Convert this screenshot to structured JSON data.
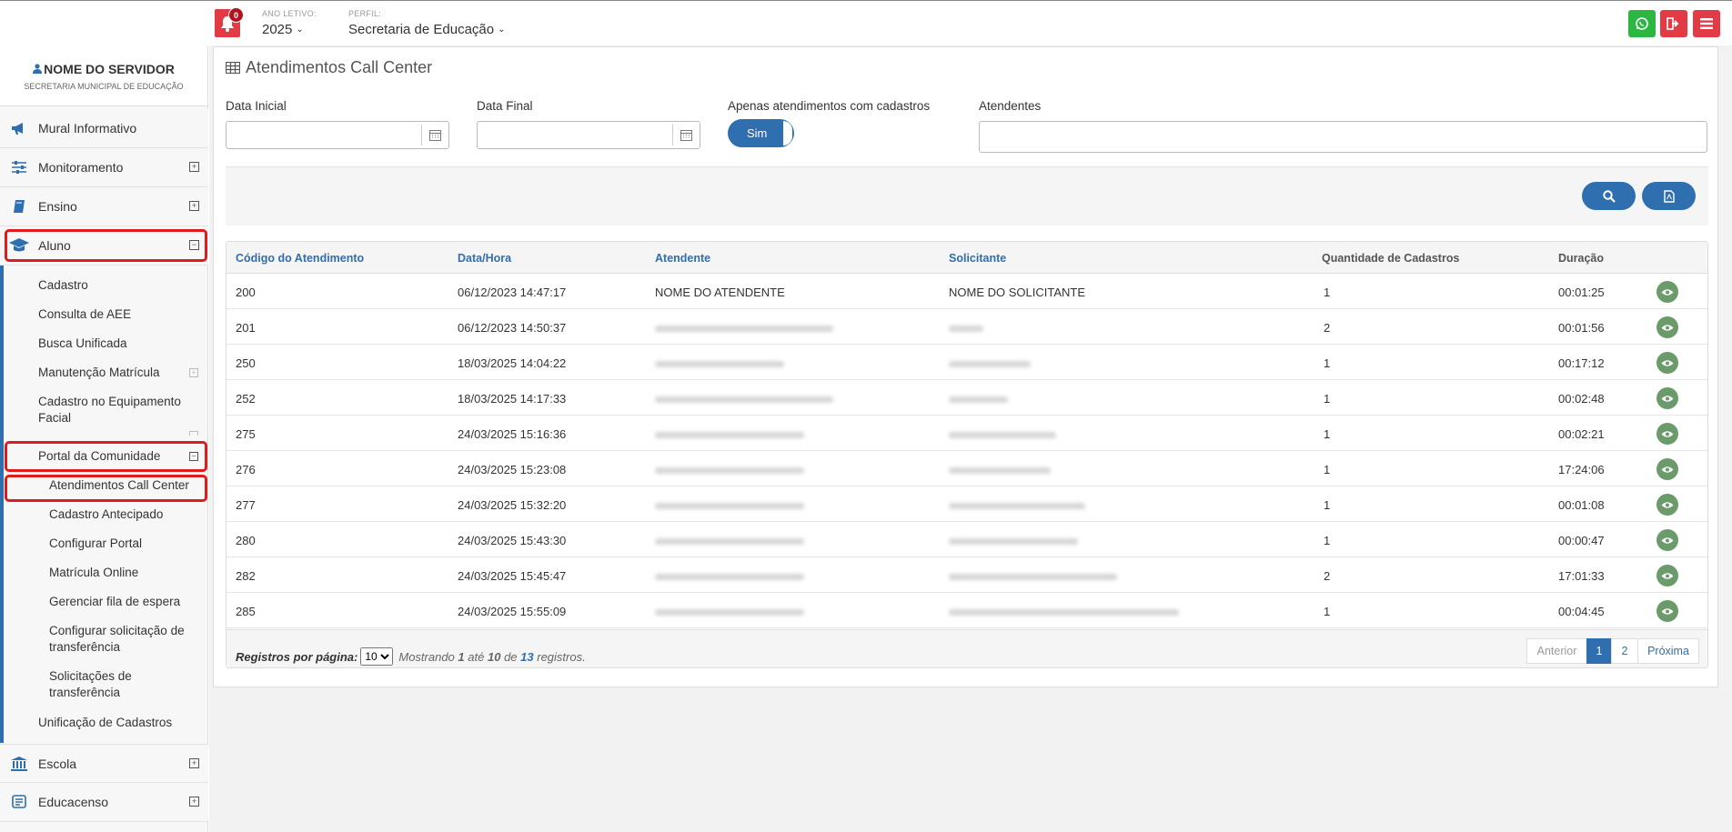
{
  "topbar": {
    "notification_count": "0",
    "ano_label": "ANO LETIVO:",
    "ano_value": "2025",
    "perfil_label": "PERFIL:",
    "perfil_value": "Secretaria de Educação"
  },
  "user": {
    "name": "NOME DO SERVIDOR",
    "org": "SECRETARIA MUNICIPAL DE EDUCAÇÃO"
  },
  "sidebar": {
    "mural": "Mural Informativo",
    "monitoramento": "Monitoramento",
    "ensino": "Ensino",
    "aluno": "Aluno",
    "aluno_items": {
      "cadastro": "Cadastro",
      "consulta_aee": "Consulta de AEE",
      "busca": "Busca Unificada",
      "manutencao": "Manutenção Matrícula",
      "equipamento_l1": "Cadastro no Equipamento",
      "equipamento_l2": "Facial",
      "portal": "Portal da Comunidade",
      "unificacao": "Unificação de Cadastros"
    },
    "portal_items": {
      "call_center": "Atendimentos Call Center",
      "antecipado": "Cadastro Antecipado",
      "configurar": "Configurar Portal",
      "matricula": "Matrícula Online",
      "fila": "Gerenciar fila de espera",
      "config_transf_l1": "Configurar solicitação de",
      "config_transf_l2": "transferência",
      "solic_l1": "Solicitações de",
      "solic_l2": "transferência"
    },
    "escola": "Escola",
    "educacenso": "Educacenso"
  },
  "page": {
    "title": "Atendimentos Call Center",
    "filters": {
      "data_inicial": "Data Inicial",
      "data_final": "Data Final",
      "apenas": "Apenas atendimentos com cadastros",
      "toggle_value": "Sim",
      "atendentes": "Atendentes"
    }
  },
  "table": {
    "headers": [
      "Código do Atendimento",
      "Data/Hora",
      "Atendente",
      "Solicitante",
      "Quantidade de Cadastros",
      "Duração"
    ],
    "rows": [
      {
        "codigo": "200",
        "data": "06/12/2023 14:47:17",
        "atendente": "NOME DO ATENDENTE",
        "solicitante": "NOME DO SOLICITANTE",
        "qtd": "1",
        "duracao": "00:01:25"
      },
      {
        "codigo": "201",
        "data": "06/12/2023 14:50:37",
        "atendente": "",
        "solicitante": "",
        "qtd": "2",
        "duracao": "00:01:56"
      },
      {
        "codigo": "250",
        "data": "18/03/2025 14:04:22",
        "atendente": "",
        "solicitante": "",
        "qtd": "1",
        "duracao": "00:17:12"
      },
      {
        "codigo": "252",
        "data": "18/03/2025 14:17:33",
        "atendente": "",
        "solicitante": "",
        "qtd": "1",
        "duracao": "00:02:48"
      },
      {
        "codigo": "275",
        "data": "24/03/2025 15:16:36",
        "atendente": "",
        "solicitante": "",
        "qtd": "1",
        "duracao": "00:02:21"
      },
      {
        "codigo": "276",
        "data": "24/03/2025 15:23:08",
        "atendente": "",
        "solicitante": "",
        "qtd": "1",
        "duracao": "17:24:06"
      },
      {
        "codigo": "277",
        "data": "24/03/2025 15:32:20",
        "atendente": "",
        "solicitante": "",
        "qtd": "1",
        "duracao": "00:01:08"
      },
      {
        "codigo": "280",
        "data": "24/03/2025 15:43:30",
        "atendente": "",
        "solicitante": "",
        "qtd": "1",
        "duracao": "00:00:47"
      },
      {
        "codigo": "282",
        "data": "24/03/2025 15:45:47",
        "atendente": "",
        "solicitante": "",
        "qtd": "2",
        "duracao": "17:01:33"
      },
      {
        "codigo": "285",
        "data": "24/03/2025 15:55:09",
        "atendente": "",
        "solicitante": "",
        "qtd": "1",
        "duracao": "00:04:45"
      }
    ]
  },
  "footer": {
    "registros_label": "Registros por página:",
    "per_page": "10",
    "mostrando": "Mostrando",
    "from": "1",
    "ate": "até",
    "to": "10",
    "de": "de",
    "total": "13",
    "registros": "registros.",
    "pagination": {
      "prev": "Anterior",
      "page1": "1",
      "page2": "2",
      "next": "Próxima"
    }
  },
  "colors": {
    "primary": "#2f6fb0",
    "danger": "#e23b46",
    "whatsapp": "#2cb742",
    "view": "#6b9a6b",
    "highlight": "#e01b1b"
  }
}
